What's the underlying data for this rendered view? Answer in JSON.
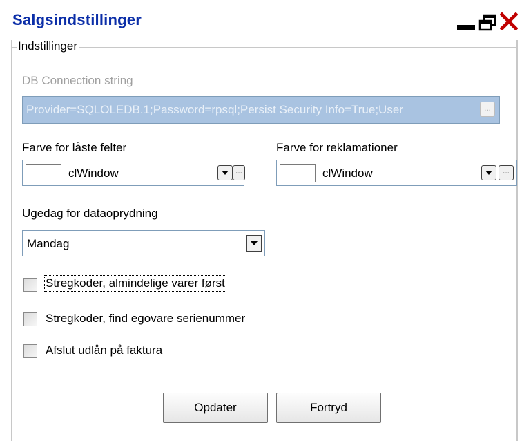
{
  "window": {
    "title": "Salgsindstillinger",
    "controls": [
      "minimize-icon",
      "restore-icon",
      "close-icon"
    ]
  },
  "group": {
    "legend": "Indstillinger"
  },
  "db": {
    "label": "DB Connection string",
    "value": "Provider=SQLOLEDB.1;Password=rpsql;Persist Security Info=True;User",
    "ellipsis": "..."
  },
  "locked_color": {
    "label": "Farve for låste felter",
    "value": "clWindow",
    "ellipsis": "..."
  },
  "claims_color": {
    "label": "Farve for reklamationer",
    "value": "clWindow",
    "ellipsis": "..."
  },
  "cleanup_day": {
    "label": "Ugedag for dataoprydning",
    "value": "Mandag"
  },
  "checkboxes": [
    {
      "label": "Stregkoder, almindelige varer først",
      "checked": false
    },
    {
      "label": "Stregkoder, find egovare serienummer",
      "checked": false
    },
    {
      "label": "Afslut udlån på faktura",
      "checked": false
    }
  ],
  "buttons": {
    "update": "Opdater",
    "cancel": "Fortryd"
  },
  "colors": {
    "title": "#0b2ea8",
    "close": "#c00000",
    "db_field_bg": "#a9c3e1"
  }
}
